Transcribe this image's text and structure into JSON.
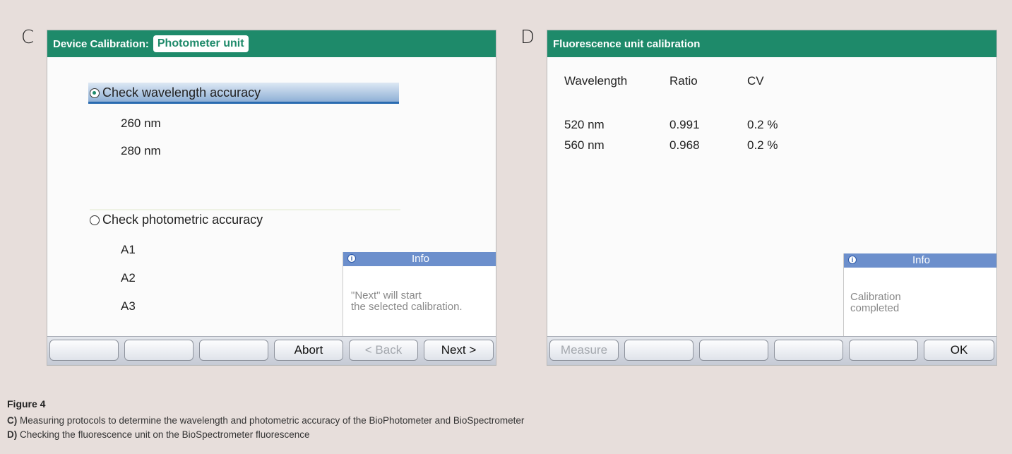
{
  "panel_c": {
    "letter": "C",
    "title_prefix": "Device Calibration:",
    "title_highlight": "Photometer unit",
    "option_wavelength": "Check wavelength accuracy",
    "wl_items": [
      "260 nm",
      "280 nm"
    ],
    "option_photometric": "Check photometric accuracy",
    "ph_items": [
      "A1",
      "A2",
      "A3"
    ],
    "info_title": "Info",
    "info_text": "\"Next\" will start\nthe selected calibration.",
    "buttons": [
      "",
      "",
      "",
      "Abort",
      "< Back",
      "Next >"
    ]
  },
  "panel_d": {
    "letter": "D",
    "title": "Fluorescence unit calibration",
    "headers": [
      "Wavelength",
      "Ratio",
      "CV"
    ],
    "rows": [
      [
        "520 nm",
        "0.991",
        "0.2 %"
      ],
      [
        "560 nm",
        "0.968",
        "0.2 %"
      ]
    ],
    "info_title": "Info",
    "info_text": "Calibration\ncompleted",
    "buttons": [
      "Measure",
      "",
      "",
      "",
      "",
      "OK"
    ]
  },
  "caption": {
    "title": "Figure 4",
    "line_c_label": "C)",
    "line_c_text": "Measuring protocols to determine the wavelength and photometric accuracy of the BioPhotometer and BioSpectrometer",
    "line_d_label": "D)",
    "line_d_text": "Checking the fluorescence unit on the BioSpectrometer fluorescence"
  },
  "colors": {
    "titlebar": "#1e8a6a",
    "info_header": "#6c8fcc",
    "background": "#e7dedb"
  }
}
